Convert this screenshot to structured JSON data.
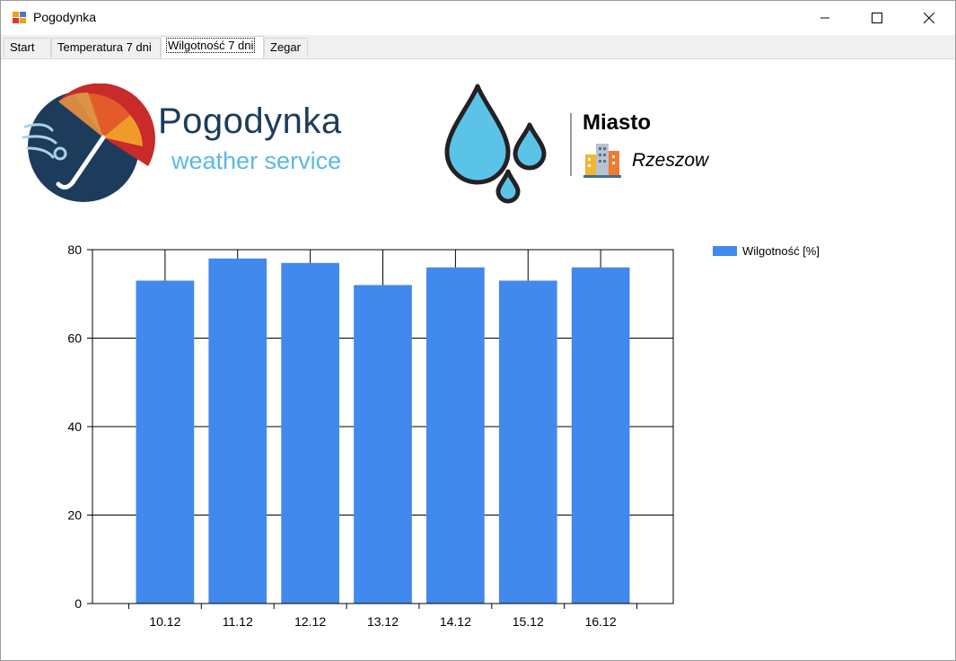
{
  "window": {
    "title": "Pogodynka",
    "icon": "app-window-icon",
    "controls": [
      "minimize-icon",
      "maximize-icon",
      "close-icon"
    ]
  },
  "tabs": [
    {
      "label": "Start",
      "active": false
    },
    {
      "label": "Temperatura 7 dni",
      "active": false
    },
    {
      "label": "Wilgotność 7 dni",
      "active": true
    },
    {
      "label": "Zegar",
      "active": false
    }
  ],
  "header": {
    "logo_title": "Pogodynka",
    "logo_subtitle": "weather service",
    "city_label": "Miasto",
    "city_value": "Rzeszow",
    "icons": [
      "umbrella-logo-icon",
      "water-drops-icon",
      "city-buildings-icon"
    ]
  },
  "colors": {
    "bar": "#4189ec",
    "logo_dark": "#1d3c5c",
    "logo_light": "#5bb8e6"
  },
  "chart_data": {
    "type": "bar",
    "categories": [
      "10.12",
      "11.12",
      "12.12",
      "13.12",
      "14.12",
      "15.12",
      "16.12"
    ],
    "series": [
      {
        "name": "Wilgotność [%]",
        "values": [
          73,
          78,
          77,
          72,
          76,
          73,
          76
        ]
      }
    ],
    "ylim": [
      0,
      80
    ],
    "yticks": [
      0,
      20,
      40,
      60,
      80
    ],
    "grid": true,
    "legend_position": "top-right"
  }
}
